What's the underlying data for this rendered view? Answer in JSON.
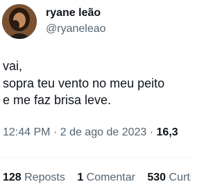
{
  "author": {
    "display_name": "ryane leão",
    "handle": "@ryaneleao",
    "avatar_icon": "profile-photo"
  },
  "tweet": {
    "lines": [
      "vai,",
      "sopra teu vento no meu peito",
      "e me faz brisa leve."
    ],
    "time": "12:44 PM",
    "separator": "·",
    "date": "2 de ago de 2023",
    "views_count": "16,3"
  },
  "stats": {
    "reposts_count": "128",
    "reposts_label": "Reposts",
    "comments_count": "1",
    "comments_label": "Comentar",
    "likes_count": "530",
    "likes_label": "Curtidas"
  },
  "colors": {
    "text_primary": "#0f1419",
    "text_secondary": "#536471",
    "divider": "#eff3f4"
  }
}
